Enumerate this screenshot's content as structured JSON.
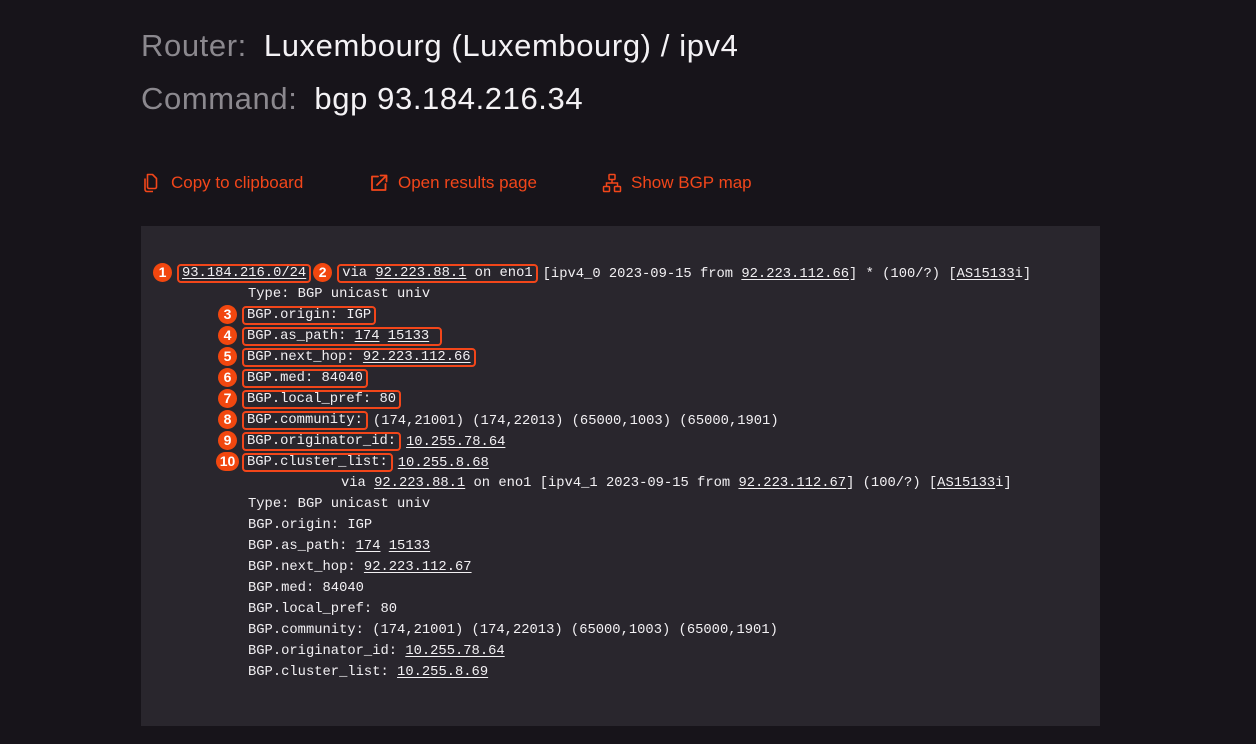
{
  "header": {
    "router_label": "Router:",
    "router_value": "Luxembourg (Luxembourg) / ipv4",
    "command_label": "Command:",
    "command_value": "bgp 93.184.216.34"
  },
  "actions": [
    {
      "label": "Copy to clipboard",
      "icon": "copy-icon"
    },
    {
      "label": "Open results page",
      "icon": "external-link-icon"
    },
    {
      "label": "Show BGP map",
      "icon": "sitemap-icon"
    }
  ],
  "colors": {
    "accent": "#f2461a",
    "badge": "#f2470f",
    "page_bg": "#17141a",
    "output_bg": "#29262d",
    "text": "#f2f0f3",
    "label": "#8b888e"
  },
  "annotations": [
    "1",
    "2",
    "3",
    "4",
    "5",
    "6",
    "7",
    "8",
    "9",
    "10"
  ],
  "routes": [
    {
      "prefix": "93.184.216.0/24",
      "via_pre": "via ",
      "gateway": "92.223.88.1",
      "via_post": " on eno1",
      "meta_pre": "[ipv4_0 2023-09-15 from ",
      "from": "92.223.112.66",
      "meta_mid": "] * (100/?) [",
      "as": "AS15133",
      "meta_post": "i]",
      "type": "Type: BGP unicast univ",
      "origin": {
        "key": "BGP.origin:",
        "value": "IGP"
      },
      "as_path": {
        "key": "BGP.as_path:",
        "values": [
          "174",
          "15133"
        ]
      },
      "next_hop": {
        "key": "BGP.next_hop:",
        "value": "92.223.112.66"
      },
      "med": {
        "key": "BGP.med:",
        "value": "84040"
      },
      "local_pref": {
        "key": "BGP.local_pref:",
        "value": "80"
      },
      "community": {
        "key": "BGP.community:",
        "value": "(174,21001) (174,22013) (65000,1003) (65000,1901)"
      },
      "originator_id": {
        "key": "BGP.originator_id:",
        "value": "10.255.78.64"
      },
      "cluster_list": {
        "key": "BGP.cluster_list:",
        "value": "10.255.8.68"
      }
    },
    {
      "via_pre": "via ",
      "gateway": "92.223.88.1",
      "via_post": " on eno1",
      "meta_pre": "[ipv4_1 2023-09-15 from ",
      "from": "92.223.112.67",
      "meta_mid": "] (100/?) [",
      "as": "AS15133",
      "meta_post": "i]",
      "type": "Type: BGP unicast univ",
      "origin": {
        "key": "BGP.origin:",
        "value": "IGP"
      },
      "as_path": {
        "key": "BGP.as_path:",
        "values": [
          "174",
          "15133"
        ]
      },
      "next_hop": {
        "key": "BGP.next_hop:",
        "value": "92.223.112.67"
      },
      "med": {
        "key": "BGP.med:",
        "value": "84040"
      },
      "local_pref": {
        "key": "BGP.local_pref:",
        "value": "80"
      },
      "community": {
        "key": "BGP.community:",
        "value": "(174,21001) (174,22013) (65000,1003) (65000,1901)"
      },
      "originator_id": {
        "key": "BGP.originator_id:",
        "value": "10.255.78.64"
      },
      "cluster_list": {
        "key": "BGP.cluster_list:",
        "value": "10.255.8.69"
      }
    }
  ]
}
